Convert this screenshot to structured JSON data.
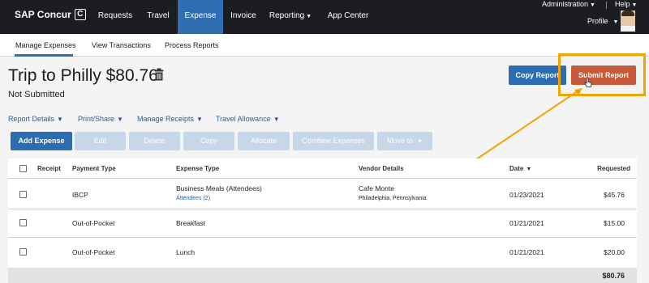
{
  "app": {
    "logo_text": "SAP Concur",
    "logo_mark": "C",
    "nav": [
      "Requests",
      "Travel",
      "Expense",
      "Invoice",
      "Reporting",
      "App Center"
    ],
    "active_nav": "Expense",
    "admin_label": "Administration",
    "help_label": "Help",
    "profile_label": "Profile"
  },
  "subnav": [
    "Manage Expenses",
    "View Transactions",
    "Process Reports"
  ],
  "report": {
    "title": "Trip to Philly $80.76",
    "status": "Not Submitted",
    "copy_label": "Copy Report",
    "submit_label": "Submit Report"
  },
  "menus": [
    "Report Details",
    "Print/Share",
    "Manage Receipts",
    "Travel Allowance"
  ],
  "toolbar": [
    "Add Expense",
    "Edit",
    "Delete",
    "Copy",
    "Allocate",
    "Combine Expenses",
    "Move to"
  ],
  "table": {
    "headers": [
      "Receipt",
      "Payment Type",
      "Expense Type",
      "Vendor Details",
      "Date",
      "Requested"
    ],
    "rows": [
      {
        "payment": "IBCP",
        "expense": "Business Meals (Attendees)",
        "attendees": "Attendees (2)",
        "vendor": "Cafe Monte",
        "location": "Philadelphia, Pennsylvania",
        "date": "01/23/2021",
        "amount": "$45.76"
      },
      {
        "payment": "Out-of-Pocket",
        "expense": "Breakfast",
        "attendees": "",
        "vendor": "",
        "location": "",
        "date": "01/21/2021",
        "amount": "$15.00"
      },
      {
        "payment": "Out-of-Pocket",
        "expense": "Lunch",
        "attendees": "",
        "vendor": "",
        "location": "",
        "date": "01/21/2021",
        "amount": "$20.00"
      }
    ],
    "total": "$80.76"
  },
  "colors": {
    "topbar": "#1b1d22",
    "accent": "#2d6db0",
    "submit": "#c65a3b",
    "highlight": "#f0a500"
  }
}
